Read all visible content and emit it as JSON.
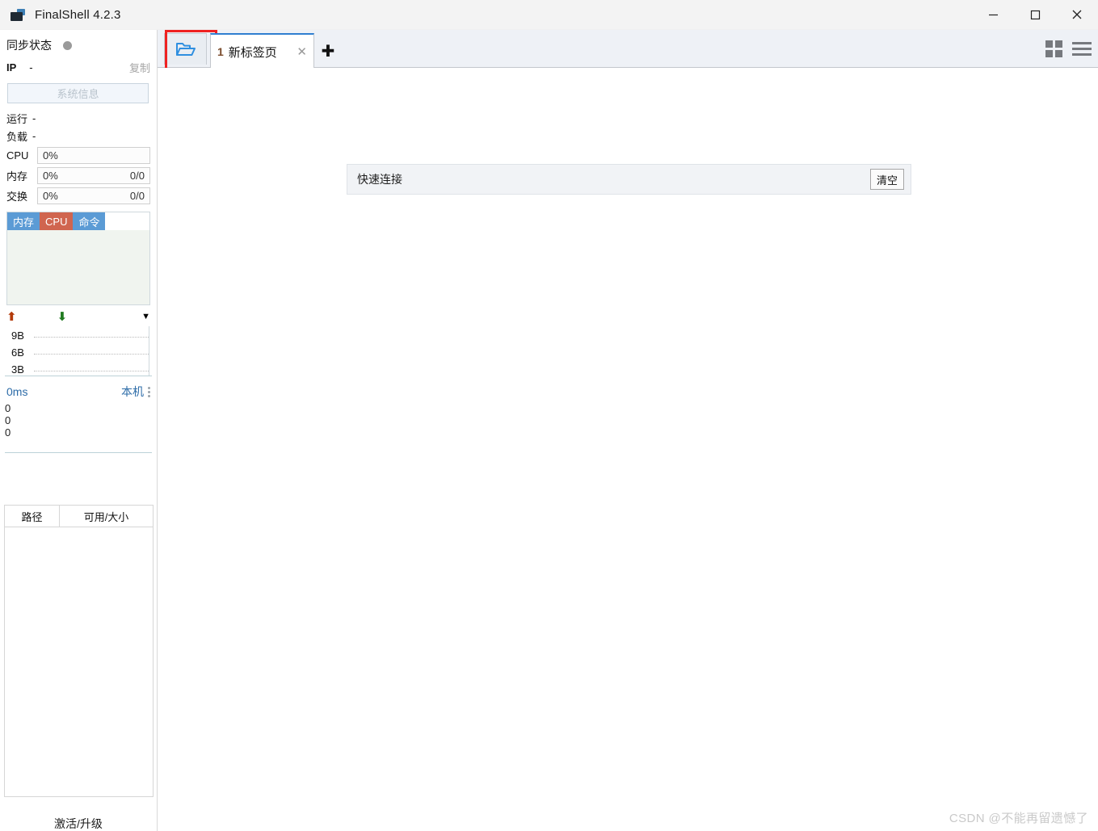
{
  "window": {
    "title": "FinalShell 4.2.3",
    "logo_icon": "computer-icon",
    "minimize_icon": "minimize-icon",
    "maximize_icon": "maximize-icon",
    "close_icon": "close-icon"
  },
  "sidebar": {
    "sync": {
      "label": "同步状态",
      "dot_icon": "status-dot-icon",
      "dot_color": "#9a9a9a"
    },
    "ip": {
      "key": "IP",
      "value": "-",
      "copy_label": "复制"
    },
    "system_info_button": "系统信息",
    "uptime": {
      "key": "运行",
      "value": "-"
    },
    "load": {
      "key": "负载",
      "value": "-"
    },
    "meters": [
      {
        "name": "CPU",
        "percent": "0%",
        "right": ""
      },
      {
        "name": "内存",
        "percent": "0%",
        "right": "0/0"
      },
      {
        "name": "交换",
        "percent": "0%",
        "right": "0/0"
      }
    ],
    "process_tabs": [
      {
        "label": "内存",
        "active": false
      },
      {
        "label": "CPU",
        "active": true
      },
      {
        "label": "命令",
        "active": false
      }
    ],
    "network": {
      "upload_icon": "arrow-up-icon",
      "download_icon": "arrow-down-icon",
      "dropdown_icon": "chevron-down-icon",
      "y_labels": [
        "9B",
        "6B",
        "3B"
      ]
    },
    "latency": {
      "value": "0ms",
      "host": "本机",
      "handle_icon": "drag-handle-icon",
      "y_labels": [
        "0",
        "0",
        "0"
      ]
    },
    "disk_table": {
      "columns": [
        "路径",
        "可用/大小"
      ],
      "rows": []
    },
    "activate_label": "激活/升级"
  },
  "tabstrip": {
    "folder_button": {
      "icon": "folder-open-icon",
      "highlighted": true,
      "highlight_color": "#ef2222"
    },
    "tabs": [
      {
        "number": "1",
        "title": "新标签页",
        "close_icon": "close-icon",
        "active": true
      }
    ],
    "add_tab_icon": "plus-icon",
    "layout_icon": "grid-layout-icon",
    "menu_icon": "hamburger-menu-icon"
  },
  "main": {
    "quick_connect": {
      "label": "快速连接",
      "clear_button": "清空",
      "input_value": ""
    }
  },
  "watermark": "CSDN @不能再留遗憾了"
}
